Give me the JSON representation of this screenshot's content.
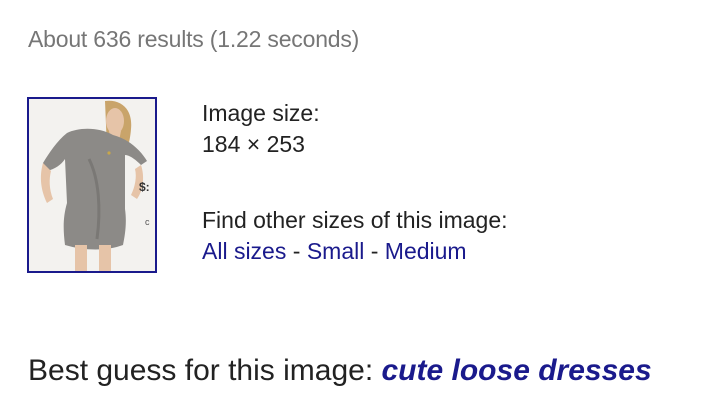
{
  "result_stats": "About 636 results (1.22 seconds)",
  "image": {
    "alt": "Thumbnail of a woman wearing a grey loose dress",
    "badge_text": "$:",
    "badge_text_2": "c"
  },
  "size_info": {
    "label": "Image size:",
    "value": "184 × 253"
  },
  "other_sizes": {
    "label": "Find other sizes of this image:",
    "links": [
      {
        "label": "All sizes"
      },
      {
        "label": "Small"
      },
      {
        "label": "Medium"
      }
    ],
    "separator": " - "
  },
  "best_guess": {
    "prefix": "Best guess for this image: ",
    "query": "cute loose dresses"
  },
  "colors": {
    "link": "#1a1a8c",
    "text": "#222222",
    "muted": "#767676",
    "dress": "#8c8a87"
  }
}
